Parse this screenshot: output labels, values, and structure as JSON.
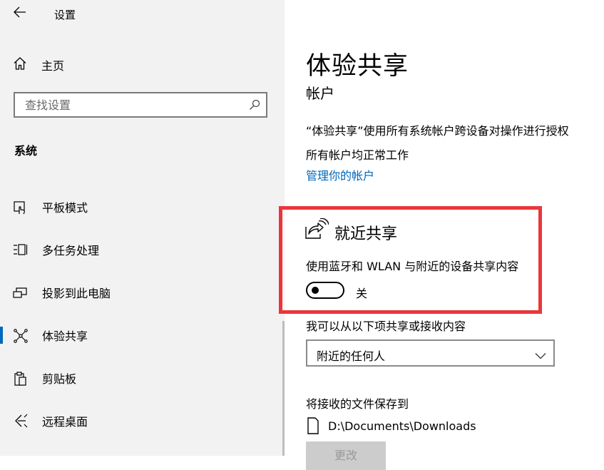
{
  "app": {
    "title": "设置"
  },
  "sidebar": {
    "home_label": "主页",
    "search_placeholder": "查找设置",
    "section_title": "系统",
    "items": [
      {
        "label": "平板模式",
        "icon": "tablet-mode-icon",
        "active": false
      },
      {
        "label": "多任务处理",
        "icon": "multitasking-icon",
        "active": false
      },
      {
        "label": "投影到此电脑",
        "icon": "project-to-pc-icon",
        "active": false
      },
      {
        "label": "体验共享",
        "icon": "shared-experiences-icon",
        "active": true
      },
      {
        "label": "剪贴板",
        "icon": "clipboard-icon",
        "active": false
      },
      {
        "label": "远程桌面",
        "icon": "remote-desktop-icon",
        "active": false
      }
    ]
  },
  "main": {
    "title": "体验共享",
    "accounts_heading": "帐户",
    "accounts_desc_line1": "“体验共享”使用所有系统帐户跨设备对操作进行授权",
    "accounts_desc_line2": "所有帐户均正常工作",
    "manage_link": "管理你的帐户",
    "nearby": {
      "title": "就近共享",
      "description": "使用蓝牙和 WLAN 与附近的设备共享内容",
      "toggle_state": "关",
      "toggle_on": false
    },
    "share_from_label": "我可以从以下项共享或接收内容",
    "share_from_value": "附近的任何人",
    "save_to_label": "将接收的文件保存到",
    "save_path": "D:\\Documents\\Downloads",
    "change_button": "更改"
  },
  "colors": {
    "accent": "#0067b8",
    "highlight_border": "#e8373c",
    "sidebar_bg": "#f2f2f2"
  }
}
